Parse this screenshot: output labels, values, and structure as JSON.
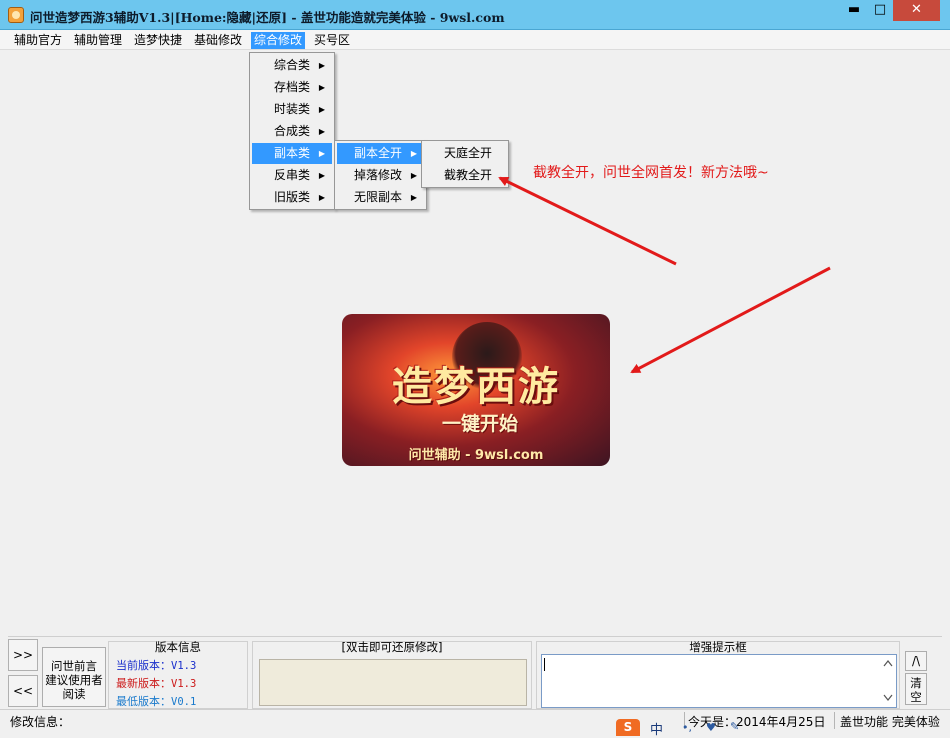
{
  "window": {
    "title": "问世造梦西游3辅助V1.3|[Home:隐藏|还原] - 盖世功能造就完美体验 - 9wsl.com",
    "min_glyph": "▬",
    "max_glyph": "□",
    "close_glyph": "✕",
    "title_bar_color": "#6dc6ee"
  },
  "menubar": {
    "items": [
      "辅助官方",
      "辅助管理",
      "造梦快捷",
      "基础修改",
      "综合修改",
      "买号区"
    ],
    "active_index": 4
  },
  "menu_level1": {
    "items": [
      "综合类",
      "存档类",
      "时装类",
      "合成类",
      "副本类",
      "反串类",
      "旧版类"
    ],
    "highlighted_index": 4
  },
  "menu_level2": {
    "items": [
      "副本全开",
      "掉落修改",
      "无限副本"
    ],
    "highlighted_index": 0
  },
  "menu_level3": {
    "items": [
      "天庭全开",
      "截教全开"
    ]
  },
  "annotation": {
    "text": "截教全开，问世全网首发！新方法哦~",
    "color": "#e21a1a"
  },
  "banner": {
    "title": "造梦西游",
    "subtitle": "一键开始",
    "footer": "问世辅助 - 9wsl.com"
  },
  "bottom_panel": {
    "expand_label": ">>",
    "collapse_label": "<<",
    "read_button": "问世前言\n建议使用者\n阅读",
    "version": {
      "title": "版本信息",
      "current_label": "当前版本：",
      "current_value": "V1.3",
      "latest_label": "最新版本：",
      "latest_value": "V1.3",
      "min_label": "最低版本：",
      "min_value": "V0.1",
      "current_color": "#1a2fcc",
      "latest_color": "#cc1a1a",
      "min_color": "#1a7acc"
    },
    "restore": {
      "title": "[双击即可还原修改]"
    },
    "hint": {
      "title": "增强提示框"
    },
    "up_button": "/\\",
    "clear_button": "清\n空"
  },
  "statusbar": {
    "left": "修改信息：",
    "date": "今天是：2014年4月25日",
    "right": "盖世功能 完美体验"
  },
  "ime": {
    "logo": "S",
    "mode": "中"
  }
}
